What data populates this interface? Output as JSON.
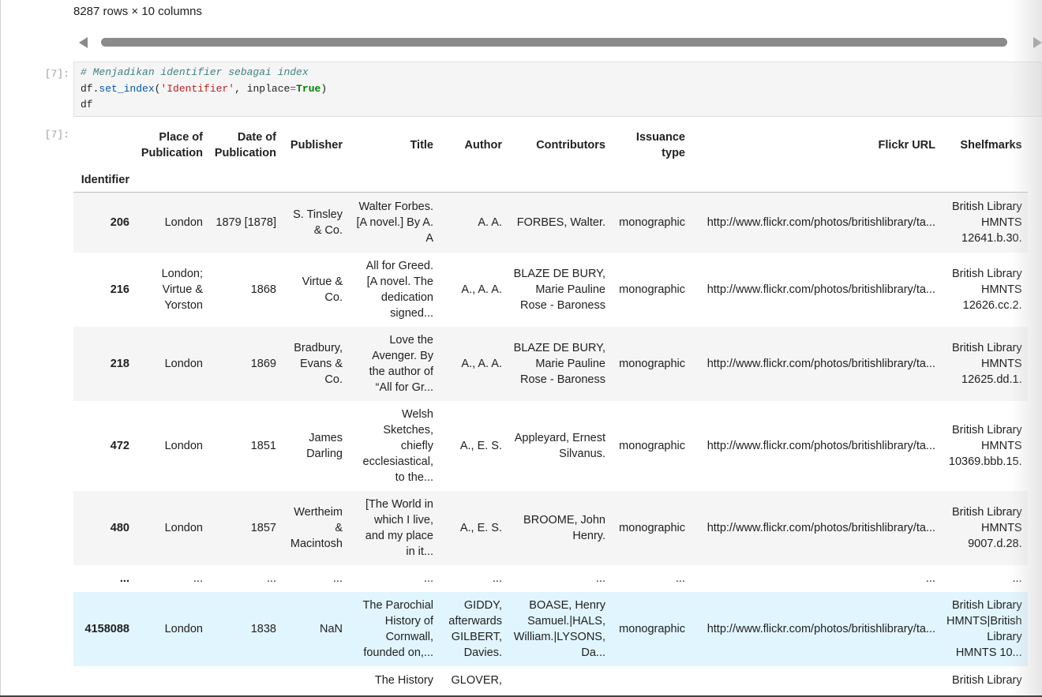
{
  "output_prev": {
    "rows_info": "8287 rows × 10 columns"
  },
  "cells": [
    {
      "prompt": "[7]:",
      "code_lines": [
        {
          "comment": "# Menjadikan identifier sebagai index"
        },
        {
          "obj": "df",
          "dot": ".",
          "method": "set_index",
          "open": "(",
          "arg_str": "'Identifier'",
          "comma": ", ",
          "kwarg": "inplace",
          "eq": "=",
          "kwval": "True",
          "close": ")"
        },
        {
          "plain": "df"
        }
      ]
    },
    {
      "prompt": "[7]:"
    }
  ],
  "table": {
    "columns": [
      "Place of\nPublication",
      "Date of\nPublication",
      "Publisher",
      "Title",
      "Author",
      "Contributors",
      "Issuance\ntype",
      "Flickr URL",
      "Shelfmarks"
    ],
    "index_name": "Identifier",
    "rows": [
      {
        "index": "206",
        "cells": [
          "London",
          "1879 [1878]",
          "S. Tinsley\n& Co.",
          "Walter Forbes.\n[A novel.] By A.\nA",
          "A. A.",
          "FORBES, Walter.",
          "monographic",
          "http://www.flickr.com/photos/britishlibrary/ta...",
          "British Library\nHMNTS\n12641.b.30."
        ]
      },
      {
        "index": "216",
        "cells": [
          "London;\nVirtue &\nYorston",
          "1868",
          "Virtue &\nCo.",
          "All for Greed.\n[A novel. The\ndedication\nsigned...",
          "A., A. A.",
          "BLAZE DE BURY,\nMarie Pauline\nRose - Baroness",
          "monographic",
          "http://www.flickr.com/photos/britishlibrary/ta...",
          "British Library\nHMNTS\n12626.cc.2."
        ]
      },
      {
        "index": "218",
        "cells": [
          "London",
          "1869",
          "Bradbury,\nEvans &\nCo.",
          "Love the\nAvenger. By\nthe author of\n“All for Gr...",
          "A., A. A.",
          "BLAZE DE BURY,\nMarie Pauline\nRose - Baroness",
          "monographic",
          "http://www.flickr.com/photos/britishlibrary/ta...",
          "British Library\nHMNTS\n12625.dd.1."
        ]
      },
      {
        "index": "472",
        "cells": [
          "London",
          "1851",
          "James\nDarling",
          "Welsh\nSketches,\nchiefly\necclesiastical,\nto the...",
          "A., E. S.",
          "Appleyard, Ernest\nSilvanus.",
          "monographic",
          "http://www.flickr.com/photos/britishlibrary/ta...",
          "British Library\nHMNTS\n10369.bbb.15."
        ]
      },
      {
        "index": "480",
        "cells": [
          "London",
          "1857",
          "Wertheim\n&\nMacintosh",
          "[The World in\nwhich I live,\nand my place\nin it...",
          "A., E. S.",
          "BROOME, John\nHenry.",
          "monographic",
          "http://www.flickr.com/photos/britishlibrary/ta...",
          "British Library\nHMNTS\n9007.d.28."
        ]
      },
      {
        "index": "...",
        "ellipsis": true,
        "cells": [
          "...",
          "...",
          "...",
          "...",
          "...",
          "...",
          "...",
          "...",
          "..."
        ]
      },
      {
        "index": "4158088",
        "highlight": true,
        "cells": [
          "London",
          "1838",
          "NaN",
          "The Parochial\nHistory of\nCornwall,\nfounded on,...",
          "GIDDY,\nafterwards\nGILBERT,\nDavies.",
          "BOASE, Henry\nSamuel.|HALS,\nWilliam.|LYSONS,\nDa...",
          "monographic",
          "http://www.flickr.com/photos/britishlibrary/ta...",
          "British Library\nHMNTS|British\nLibrary\nHMNTS 10..."
        ]
      },
      {
        "index": "",
        "cut": true,
        "cells": [
          "",
          "",
          "",
          "The History",
          "GLOVER,",
          "",
          "",
          "",
          "British Library"
        ]
      }
    ]
  }
}
